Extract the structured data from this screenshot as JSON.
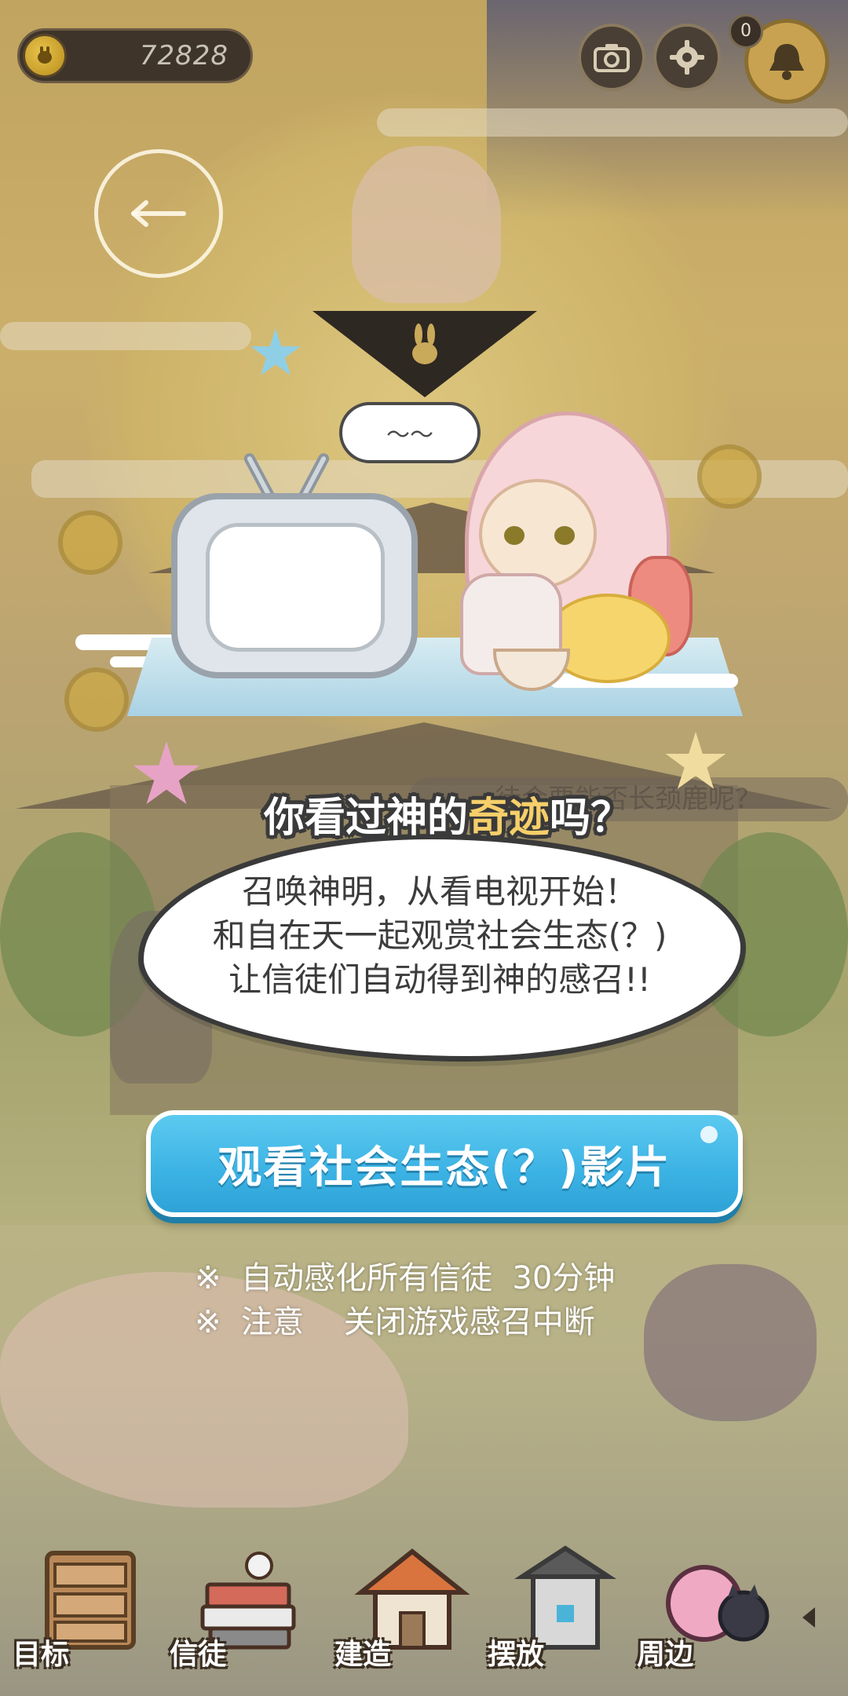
{
  "hud": {
    "coin_value": "72828",
    "notification_count": "0"
  },
  "illustration": {
    "speech_scribble": "〜〜"
  },
  "bubble": {
    "title_pre": "你看过神的",
    "title_highlight": "奇迹",
    "title_post": "吗？",
    "lines": [
      "召唤神明，从看电视开始！",
      "和自在天一起观赏社会生态(？)",
      "让信徒们自动得到神的感召!!"
    ]
  },
  "cta": {
    "label": "观看社会生态(？)影片"
  },
  "notes": [
    "※  自动感化所有信徒  30分钟",
    "※  注意    关闭游戏感召中断"
  ],
  "background": {
    "faded_caption": "待会要能否长颈鹿呢？"
  },
  "nav": {
    "items": [
      {
        "label": "目标",
        "icon": "drawer-icon"
      },
      {
        "label": "信徒",
        "icon": "books-icon"
      },
      {
        "label": "建造",
        "icon": "house-icon"
      },
      {
        "label": "摆放",
        "icon": "shrine-icon"
      },
      {
        "label": "周边",
        "icon": "merch-icon"
      }
    ]
  },
  "colors": {
    "cta_blue": "#3bb2e4",
    "title_highlight": "#f6cf6a",
    "bubble_outline": "#3a3a3a"
  }
}
